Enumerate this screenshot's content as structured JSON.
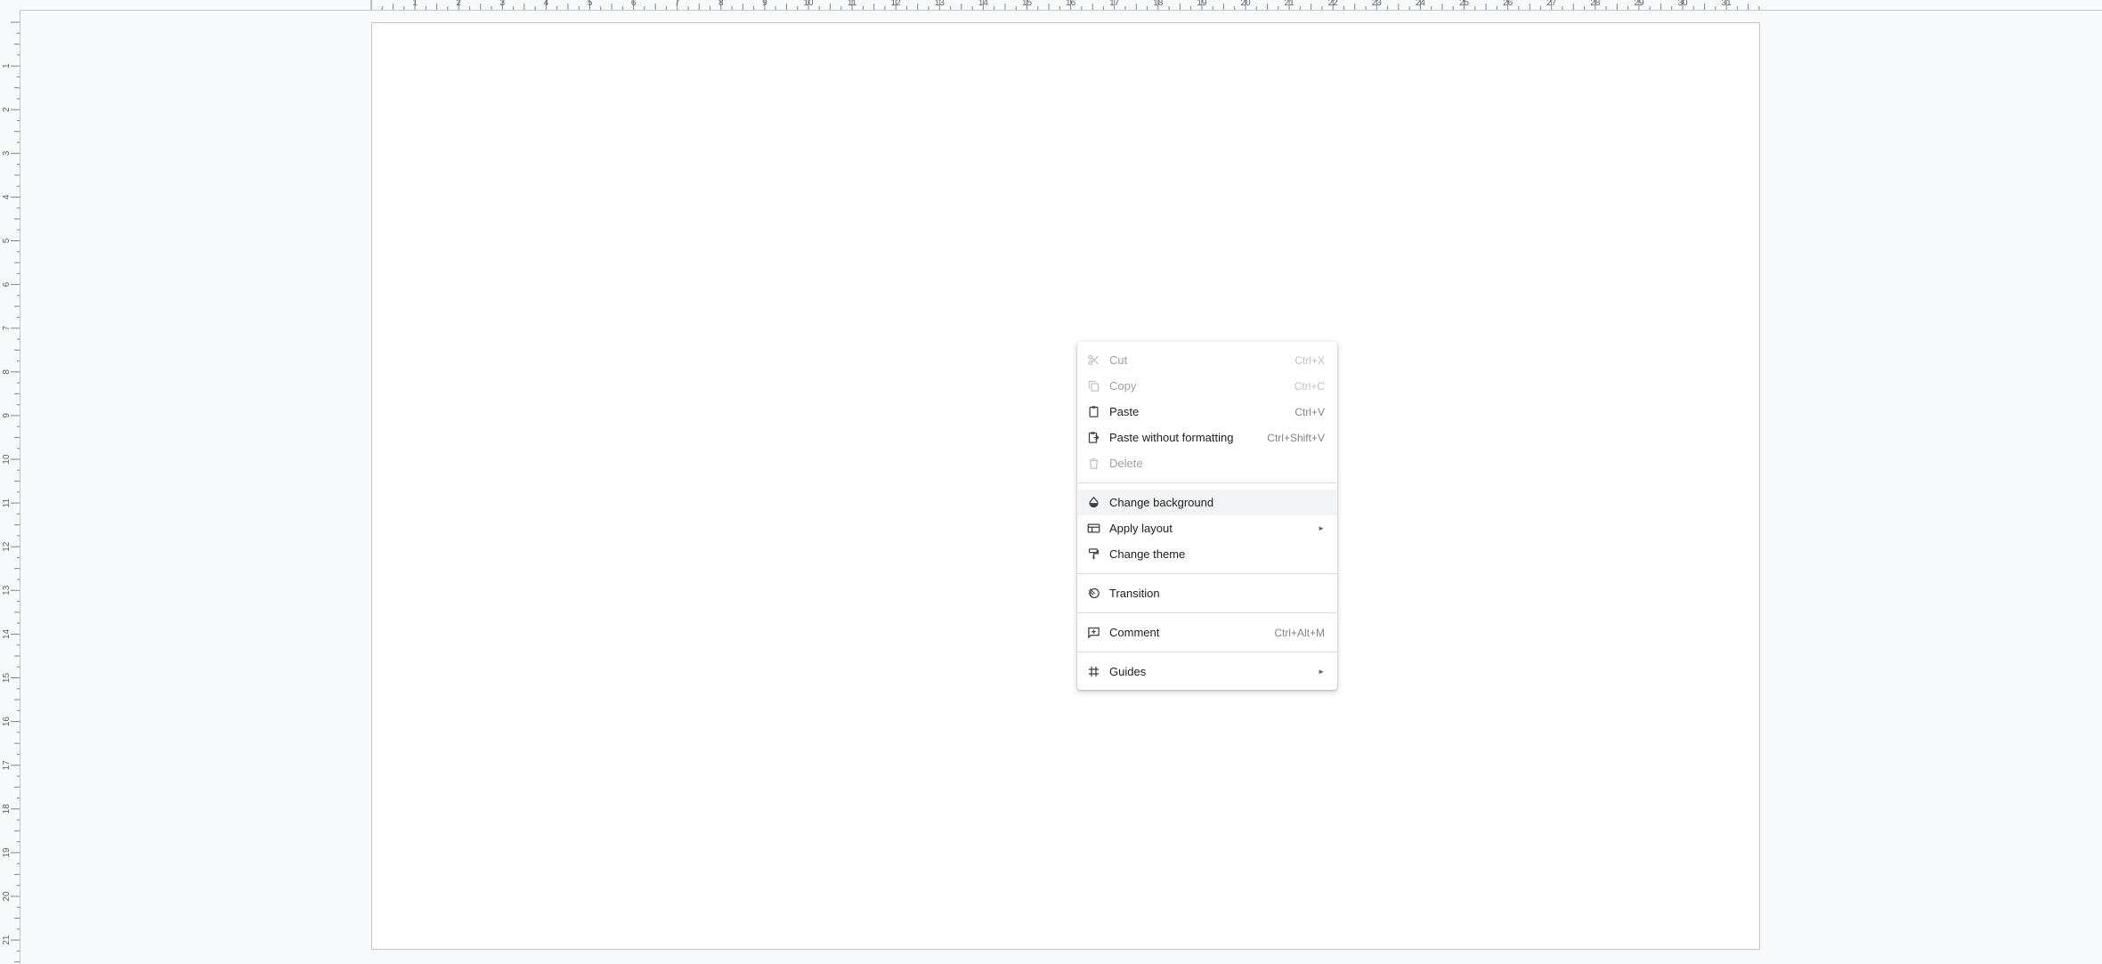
{
  "ruler": {
    "top_labels": [
      "1",
      "2",
      "3",
      "4",
      "5",
      "6",
      "7",
      "8",
      "9",
      "10",
      "11",
      "12",
      "13",
      "14",
      "15",
      "16",
      "17",
      "18",
      "19",
      "20",
      "21",
      "22",
      "23",
      "24",
      "25",
      "26",
      "27",
      "28",
      "29",
      "30",
      "31"
    ],
    "left_labels": [
      "1",
      "2",
      "3",
      "4",
      "5",
      "6",
      "7",
      "8",
      "9",
      "10",
      "11",
      "12",
      "13",
      "14",
      "15",
      "16",
      "17",
      "18",
      "19",
      "20",
      "21"
    ]
  },
  "context_menu": {
    "items": [
      {
        "label": "Cut",
        "shortcut": "Ctrl+X",
        "icon": "scissors-icon",
        "disabled": true
      },
      {
        "label": "Copy",
        "shortcut": "Ctrl+C",
        "icon": "copy-icon",
        "disabled": true
      },
      {
        "label": "Paste",
        "shortcut": "Ctrl+V",
        "icon": "clipboard-icon",
        "disabled": false
      },
      {
        "label": "Paste without formatting",
        "shortcut": "Ctrl+Shift+V",
        "icon": "clipboard-text-icon",
        "disabled": false
      },
      {
        "label": "Delete",
        "shortcut": "",
        "icon": "trash-icon",
        "disabled": true
      },
      {
        "label": "Change background",
        "shortcut": "",
        "icon": "paint-drop-icon",
        "disabled": false,
        "highlighted": true
      },
      {
        "label": "Apply layout",
        "shortcut": "",
        "icon": "layout-icon",
        "disabled": false,
        "submenu": true
      },
      {
        "label": "Change theme",
        "shortcut": "",
        "icon": "paint-roller-icon",
        "disabled": false
      },
      {
        "label": "Transition",
        "shortcut": "",
        "icon": "transition-icon",
        "disabled": false
      },
      {
        "label": "Comment",
        "shortcut": "Ctrl+Alt+M",
        "icon": "add-comment-icon",
        "disabled": false
      },
      {
        "label": "Guides",
        "shortcut": "",
        "icon": "grid-icon",
        "disabled": false,
        "submenu": true
      }
    ],
    "submenu_arrow": "►"
  },
  "colors": {
    "workspace_bg": "#f8f9fa",
    "slide_bg": "#ffffff",
    "text": "#202124",
    "disabled_text": "#9aa0a6",
    "highlight_bg": "#f1f3f4"
  }
}
